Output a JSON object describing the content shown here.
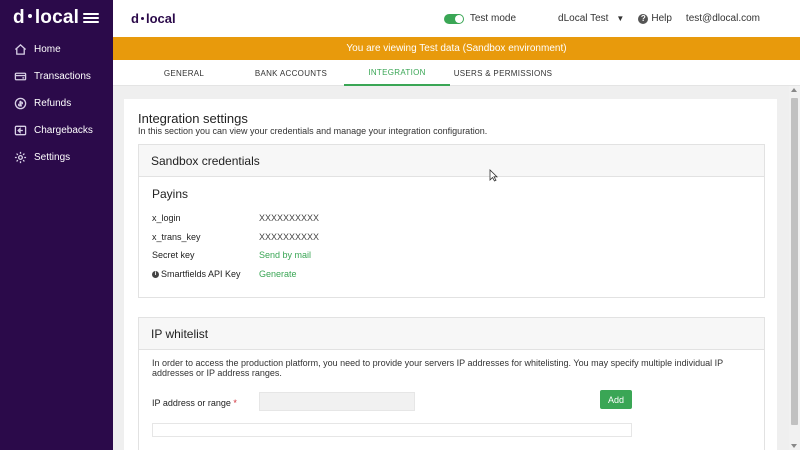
{
  "sidebar": {
    "logo_left": "d",
    "logo_right": "local",
    "items": [
      {
        "label": "Home",
        "icon": "home-icon"
      },
      {
        "label": "Transactions",
        "icon": "transactions-icon"
      },
      {
        "label": "Refunds",
        "icon": "refunds-icon"
      },
      {
        "label": "Chargebacks",
        "icon": "chargebacks-icon"
      },
      {
        "label": "Settings",
        "icon": "gear-icon"
      }
    ]
  },
  "header": {
    "logo_left": "d",
    "logo_right": "local",
    "test_mode_label": "Test mode",
    "test_mode_on": true,
    "account_name": "dLocal Test",
    "help_label": "Help",
    "user_email": "test@dlocal.com"
  },
  "banner": {
    "text": "You are viewing Test data (Sandbox environment)",
    "color": "#e89a0c"
  },
  "tabs": [
    {
      "label": "GENERAL",
      "active": false
    },
    {
      "label": "BANK ACCOUNTS",
      "active": false
    },
    {
      "label": "INTEGRATION",
      "active": true
    },
    {
      "label": "USERS & PERMISSIONS",
      "active": false
    }
  ],
  "integration": {
    "title": "Integration settings",
    "description": "In this section you can view your credentials and manage your integration configuration.",
    "sandbox": {
      "title": "Sandbox credentials",
      "section": "Payins",
      "rows": [
        {
          "label": "x_login",
          "value": "XXXXXXXXXX"
        },
        {
          "label": "x_trans_key",
          "value": "XXXXXXXXXX"
        },
        {
          "label": "Secret key",
          "value": "Send by mail"
        },
        {
          "label": "Smartfields API Key",
          "value": "Generate"
        }
      ]
    },
    "whitelist": {
      "title": "IP whitelist",
      "description": "In order to access the production platform, you need to provide your servers IP addresses for whitelisting. You may specify multiple individual IP addresses or IP address ranges.",
      "field_label": "IP address or range",
      "required_mark": "*",
      "field_value": "",
      "add_label": "Add"
    }
  },
  "colors": {
    "sidebar": "#2b0a4a",
    "accent": "#3aa655",
    "banner": "#e89a0c"
  }
}
